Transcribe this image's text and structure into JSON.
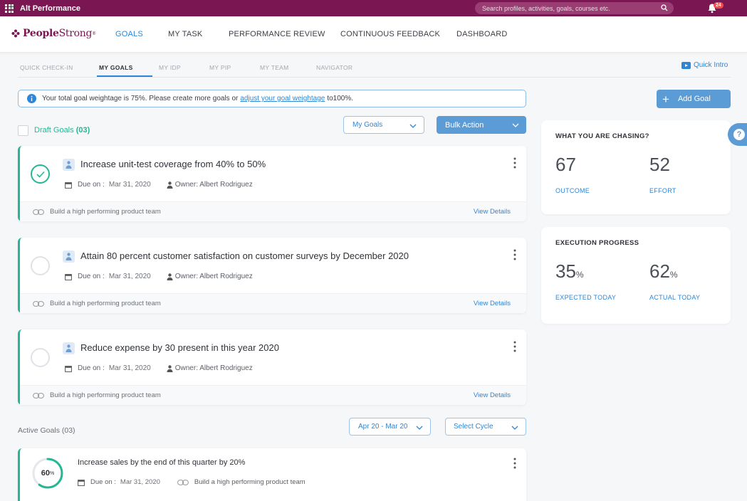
{
  "topbar": {
    "app_name": "Alt Performance",
    "search_placeholder": "Search profiles, activities, goals, courses etc.",
    "notification_count": "24"
  },
  "brand": {
    "logo_people": "People",
    "logo_strong": "Strong",
    "logo_mark": "®",
    "color": "#7a1651"
  },
  "nav": {
    "items": [
      "GOALS",
      "MY TASK",
      "PERFORMANCE REVIEW",
      "CONTINUOUS FEEDBACK",
      "DASHBOARD"
    ],
    "active": "GOALS"
  },
  "subnav": {
    "items": [
      "QUICK CHECK-IN",
      "MY GOALS",
      "MY IDP",
      "MY PIP",
      "MY TEAM",
      "NAVIGATOR"
    ],
    "active": "MY GOALS",
    "quick_intro": "Quick Intro"
  },
  "info": {
    "text_before": "Your total goal weightage is 75%. Please create more goals or",
    "link": "adjust your goal weightage",
    "text_after": "to100%."
  },
  "add_goal_label": "Add Goal",
  "draft": {
    "label": "Draft Goals",
    "count": "(03)",
    "filter_value": "My Goals",
    "bulk_action": "Bulk Action"
  },
  "draft_goals": [
    {
      "title": "Increase unit-test coverage from 40% to 50%",
      "due_label": "Due on :",
      "due_date": "Mar 31, 2020",
      "owner": "Owner: Albert Rodriguez",
      "parent": "Build a high performing product team",
      "view": "View Details",
      "checked": true
    },
    {
      "title": "Attain 80 percent customer satisfaction on customer surveys by December 2020",
      "due_label": "Due on :",
      "due_date": "Mar 31, 2020",
      "owner": "Owner: Albert Rodriguez",
      "parent": "Build a high performing product team",
      "view": "View Details",
      "checked": false
    },
    {
      "title": "Reduce expense by 30 present in this year 2020",
      "due_label": "Due on :",
      "due_date": "Mar 31, 2020",
      "owner": "Owner: Albert Rodriguez",
      "parent": "Build a high performing product team",
      "view": "View Details",
      "checked": false
    }
  ],
  "active": {
    "label": "Active Goals (03)",
    "date_range": "Apr 20 - Mar 20",
    "cycle_placeholder": "Select Cycle",
    "goal": {
      "progress": "60",
      "progress_unit": "%",
      "progress_fraction": 0.6,
      "title": "Increase sales by the end of this quarter by 20%",
      "due_label": "Due on :",
      "due_date": "Mar 31, 2020",
      "parent": "Build a high performing product team"
    }
  },
  "chasing": {
    "heading": "WHAT YOU ARE CHASING?",
    "outcome_value": "67",
    "outcome_label": "OUTCOME",
    "effort_value": "52",
    "effort_label": "EFFORT"
  },
  "execution": {
    "heading": "EXECUTION PROGRESS",
    "expected_value": "35",
    "expected_unit": "%",
    "expected_label": "EXPECTED TODAY",
    "actual_value": "62",
    "actual_unit": "%",
    "actual_label": "ACTUAL TODAY"
  },
  "help_label": "?",
  "colors": {
    "accent": "#2e86d6",
    "success": "#25b795",
    "brand": "#7a1651",
    "button": "#5b9bd6"
  }
}
